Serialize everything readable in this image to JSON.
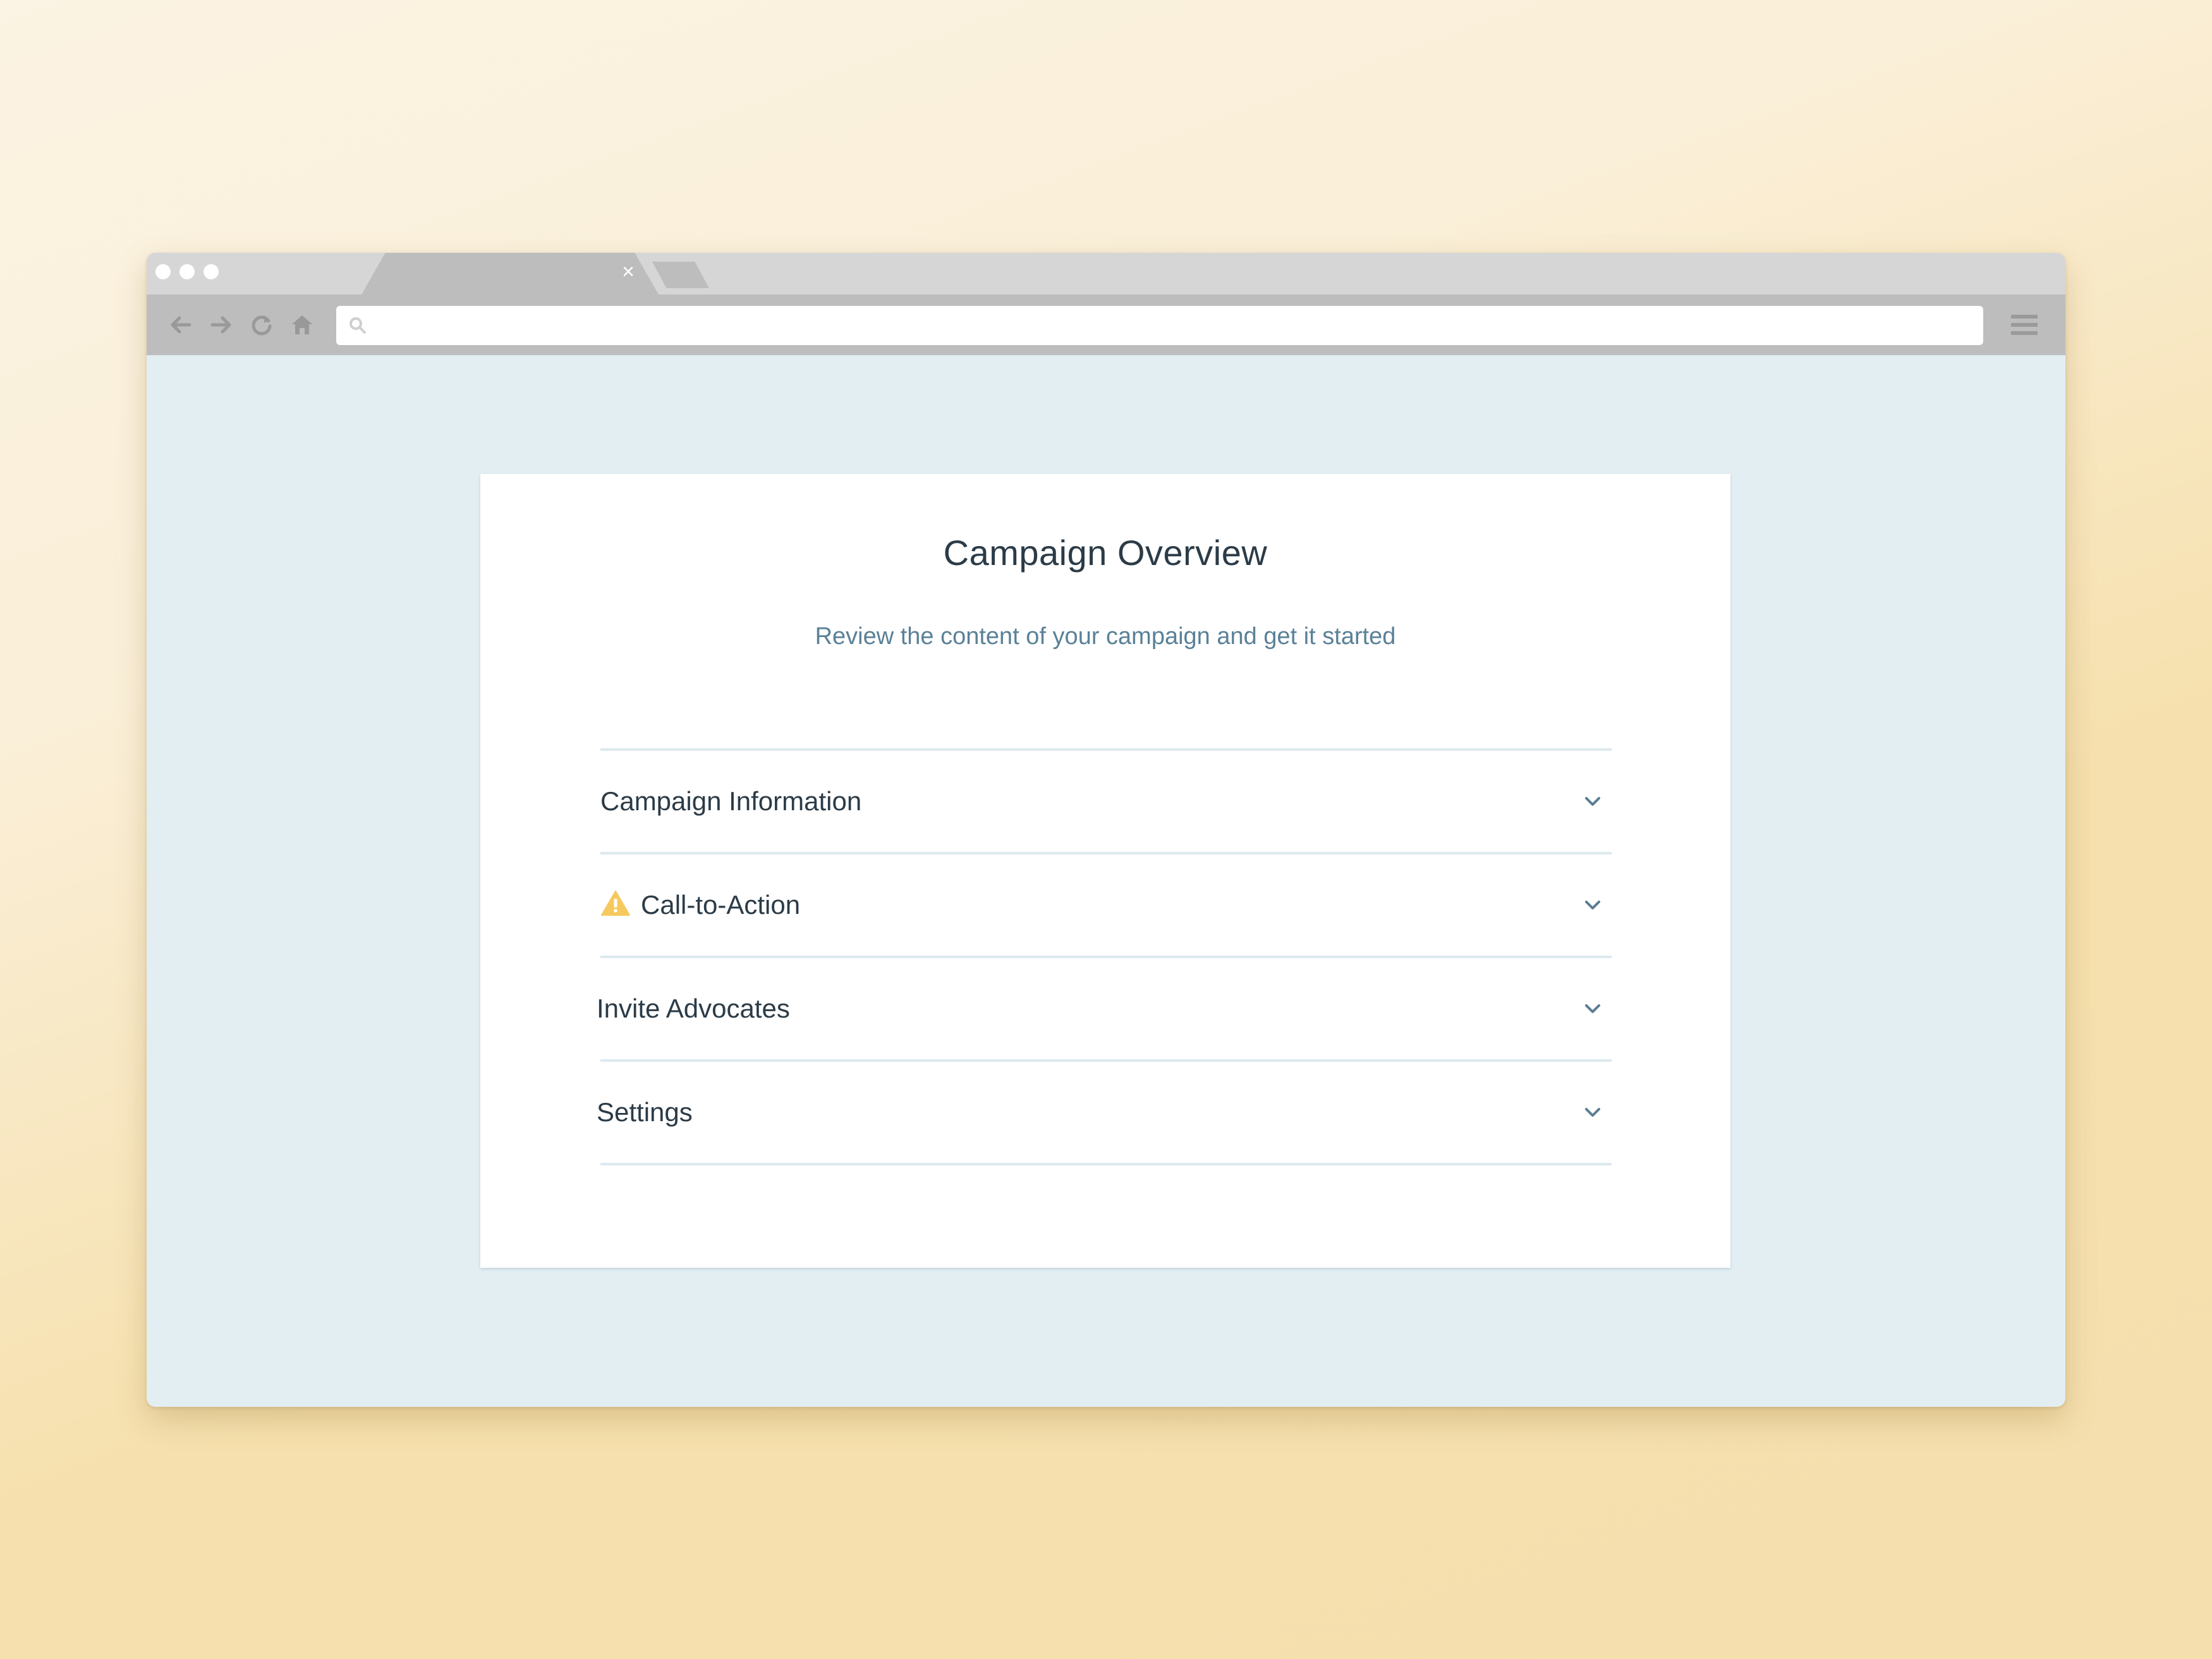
{
  "browser": {
    "tab": {
      "close_glyph": "×"
    },
    "icons": [
      "back-arrow-icon",
      "forward-arrow-icon",
      "reload-icon",
      "home-icon",
      "search-icon",
      "hamburger-menu-icon"
    ],
    "address_bar": {
      "value": "",
      "placeholder": ""
    }
  },
  "page": {
    "title": "Campaign Overview",
    "subtitle": "Review the content of your campaign and get it started",
    "sections": [
      {
        "label": "Campaign Information",
        "warning": false,
        "expanded": false
      },
      {
        "label": "Call-to-Action",
        "warning": true,
        "expanded": false
      },
      {
        "label": "Invite Advocates",
        "warning": false,
        "expanded": false
      },
      {
        "label": "Settings",
        "warning": false,
        "expanded": false
      }
    ]
  },
  "colors": {
    "page_background": "#e3eef3",
    "title_text": "#2b3b47",
    "subtitle_text": "#5a8197",
    "divider": "#dde9ee",
    "warning": "#f6c95e",
    "chevron": "#5a7d92"
  }
}
